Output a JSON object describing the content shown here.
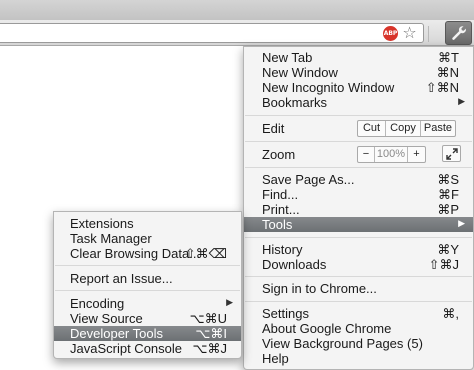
{
  "main_menu": {
    "items": [
      {
        "label": "New Tab",
        "shortcut": "⌘T"
      },
      {
        "label": "New Window",
        "shortcut": "⌘N"
      },
      {
        "label": "New Incognito Window",
        "shortcut": "⇧⌘N"
      },
      {
        "label": "Bookmarks"
      }
    ],
    "edit": {
      "label": "Edit",
      "cut": "Cut",
      "copy": "Copy",
      "paste": "Paste"
    },
    "zoom": {
      "label": "Zoom",
      "minus": "−",
      "value": "100%",
      "plus": "+"
    },
    "page_items": [
      {
        "label": "Save Page As...",
        "shortcut": "⌘S"
      },
      {
        "label": "Find...",
        "shortcut": "⌘F"
      },
      {
        "label": "Print...",
        "shortcut": "⌘P"
      },
      {
        "label": "Tools"
      }
    ],
    "history_items": [
      {
        "label": "History",
        "shortcut": "⌘Y"
      },
      {
        "label": "Downloads",
        "shortcut": "⇧⌘J"
      }
    ],
    "sign_in": "Sign in to Chrome...",
    "bottom_items": [
      {
        "label": "Settings",
        "shortcut": "⌘,"
      },
      {
        "label": "About Google Chrome"
      },
      {
        "label": "View Background Pages (5)"
      },
      {
        "label": "Help"
      }
    ]
  },
  "tools_menu": {
    "items": [
      {
        "label": "Extensions"
      },
      {
        "label": "Task Manager"
      },
      {
        "label": "Clear Browsing Data...",
        "shortcut": "⇧⌘⌫"
      },
      {
        "label": "Report an Issue..."
      },
      {
        "label": "Encoding"
      },
      {
        "label": "View Source",
        "shortcut": "⌥⌘U"
      },
      {
        "label": "Developer Tools",
        "shortcut": "⌥⌘I"
      },
      {
        "label": "JavaScript Console",
        "shortcut": "⌥⌘J"
      }
    ]
  },
  "toolbar": {
    "adblock_badge": "ABP",
    "star_icon": "bookmark-star-icon",
    "wrench_icon": "wrench-icon"
  },
  "colors": {
    "highlight": "#75797c",
    "menu_bg": "#f4f4f4",
    "adblock_red": "#d8342a"
  }
}
